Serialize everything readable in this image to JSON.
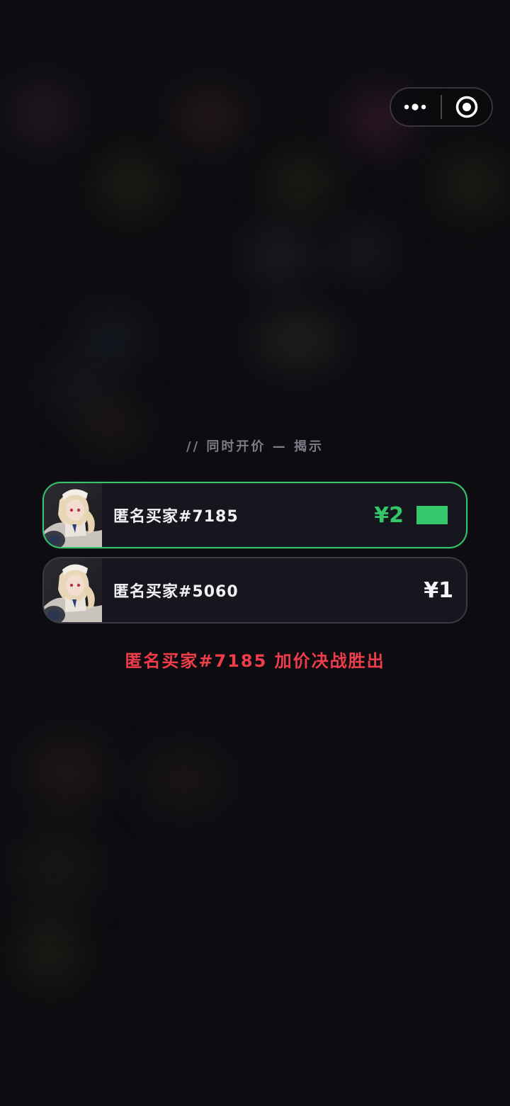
{
  "topbar": {
    "more_icon": "more-dots-icon",
    "close_icon": "target-circle-icon"
  },
  "reveal": {
    "section_label": "// 同时开价 — 揭示",
    "bids": [
      {
        "bidder": "匿名买家#7185",
        "price": "¥2",
        "winner": true,
        "avatar_icon": "anime-avatar-icon"
      },
      {
        "bidder": "匿名买家#5060",
        "price": "¥1",
        "winner": false,
        "avatar_icon": "anime-avatar-icon"
      }
    ],
    "result": "匿名买家#7185 加价决战胜出"
  },
  "colors": {
    "winner_accent": "#34c76a",
    "result_red": "#ef3d4b",
    "background": "#0d0d11"
  }
}
